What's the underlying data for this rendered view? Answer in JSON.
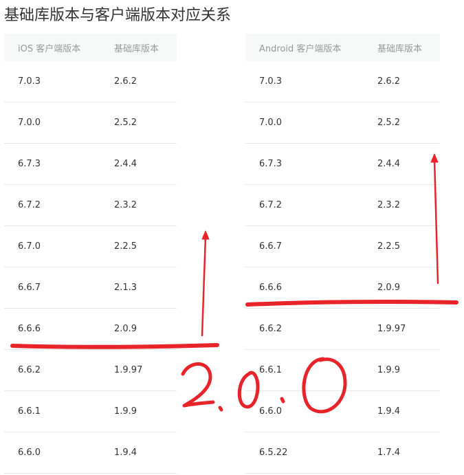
{
  "page": {
    "title": "基础库版本与客户端版本对应关系"
  },
  "ios_table": {
    "headers": [
      "iOS 客户端版本",
      "基础库版本"
    ],
    "rows": [
      [
        "7.0.3",
        "2.6.2"
      ],
      [
        "7.0.0",
        "2.5.2"
      ],
      [
        "6.7.3",
        "2.4.4"
      ],
      [
        "6.7.2",
        "2.3.2"
      ],
      [
        "6.7.0",
        "2.2.5"
      ],
      [
        "6.6.7",
        "2.1.3"
      ],
      [
        "6.6.6",
        "2.0.9"
      ],
      [
        "6.6.2",
        "1.9.97"
      ],
      [
        "6.6.1",
        "1.9.9"
      ],
      [
        "6.6.0",
        "1.9.4"
      ]
    ]
  },
  "android_table": {
    "headers": [
      "Android 客户端版本",
      "基础库版本"
    ],
    "rows": [
      [
        "7.0.3",
        "2.6.2"
      ],
      [
        "7.0.0",
        "2.5.2"
      ],
      [
        "6.7.3",
        "2.4.4"
      ],
      [
        "6.7.2",
        "2.3.2"
      ],
      [
        "6.6.7",
        "2.2.5"
      ],
      [
        "6.6.6",
        "2.0.9"
      ],
      [
        "6.6.2",
        "1.9.97"
      ],
      [
        "6.6.1",
        "1.9.9"
      ],
      [
        "6.6.0",
        "1.9.4"
      ],
      [
        "6.5.22",
        "1.7.4"
      ]
    ]
  },
  "annotation": {
    "handwritten_text": "2.0.0",
    "ink_color": "#e8242b"
  }
}
